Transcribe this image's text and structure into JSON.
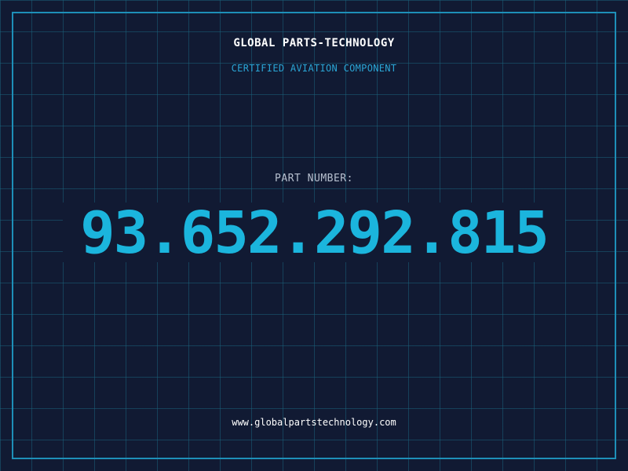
{
  "header": {
    "brand": "GLOBAL PARTS-TECHNOLOGY",
    "tagline": "CERTIFIED AVIATION COMPONENT"
  },
  "part": {
    "label": "PART NUMBER:",
    "number": "93.652.292.815"
  },
  "footer": {
    "website": "www.globalpartstechnology.com"
  },
  "colors": {
    "background": "#111a33",
    "grid": "#1a607a",
    "frame": "#1e8fb8",
    "accent": "#1bb5dd",
    "tagline": "#2aa6d6",
    "label": "#b7c0cf",
    "text": "#ffffff"
  }
}
